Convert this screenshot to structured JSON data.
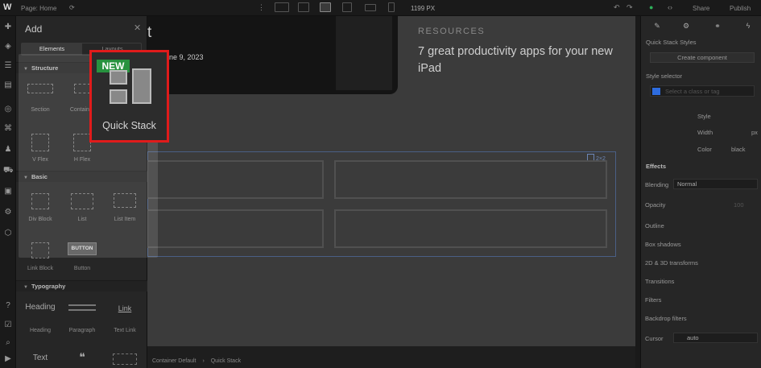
{
  "topbar": {
    "logo": "W",
    "page_label": "Page: Home",
    "width_readout": "1199 PX",
    "share_label": "Share",
    "publish_label": "Publish"
  },
  "add_panel": {
    "title": "Add",
    "tabs": [
      "Elements",
      "Layouts"
    ],
    "sections": [
      {
        "label": "Structure",
        "items": [
          "Section",
          "Container",
          "V Flex",
          "H Flex"
        ]
      },
      {
        "label": "Basic",
        "items": [
          "Div Block",
          "List",
          "List Item",
          "Link Block",
          "Button"
        ]
      },
      {
        "label": "Typography",
        "items": [
          "Heading",
          "Paragraph",
          "Text Link",
          "Text"
        ]
      }
    ],
    "button_preview": "BUTTON",
    "heading_preview": "Heading",
    "link_preview": "Link",
    "text_preview": "Text"
  },
  "canvas": {
    "card_title_fragment": "t",
    "card_date": "ne 9, 2023",
    "category": "RESOURCES",
    "headline": "7 great productivity apps for your new iPad",
    "quick_stack_badge": "2×2"
  },
  "breadcrumb": [
    "Container Default",
    "Quick Stack"
  ],
  "quick_stack_card": {
    "badge": "NEW",
    "label": "Quick Stack",
    "badge_color": "#27923f",
    "highlight_color": "#e01b1b"
  },
  "style_panel": {
    "styles_title": "Quick Stack Styles",
    "create_component": "Create component",
    "style_selector_label": "Style selector",
    "style_selector_placeholder": "Select a class or tag",
    "style_label": "Style",
    "width_label": "Width",
    "width_unit": "px",
    "color_label": "Color",
    "color_value": "black",
    "effects_label": "Effects",
    "blending_label": "Blending",
    "blending_value": "Normal",
    "opacity_label": "Opacity",
    "opacity_value": "100",
    "outline_label": "Outline",
    "box_shadows_label": "Box shadows",
    "transforms_label": "2D & 3D transforms",
    "transitions_label": "Transitions",
    "filters_label": "Filters",
    "backdrop_label": "Backdrop filters",
    "cursor_label": "Cursor",
    "cursor_value": "auto"
  }
}
